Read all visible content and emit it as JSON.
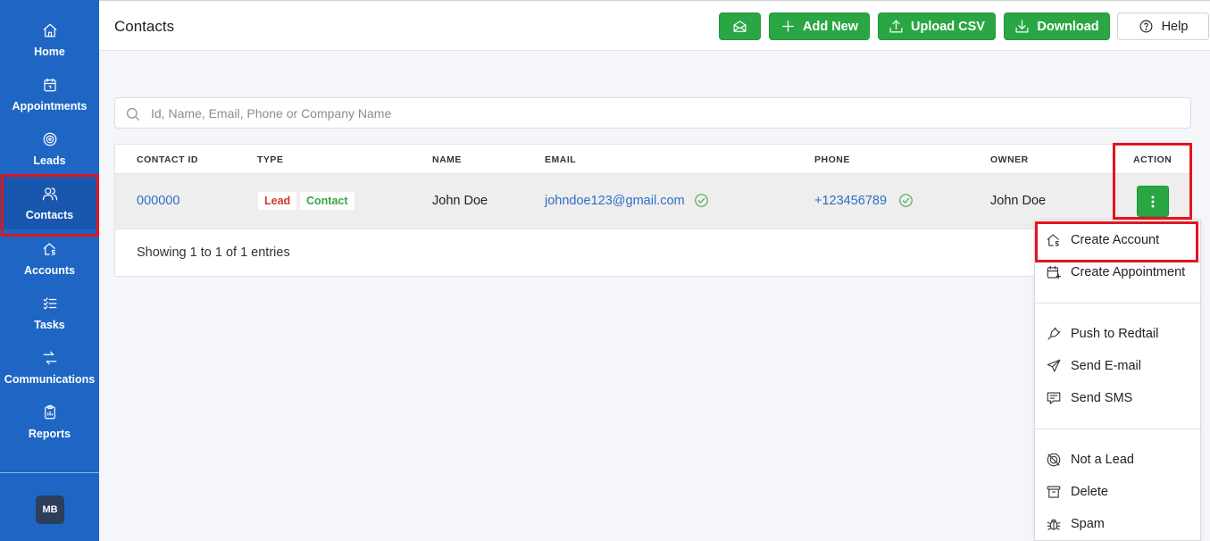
{
  "sidebar": {
    "items": [
      {
        "label": "Home",
        "icon": "home-icon"
      },
      {
        "label": "Appointments",
        "icon": "calendar-icon"
      },
      {
        "label": "Leads",
        "icon": "target-icon"
      },
      {
        "label": "Contacts",
        "icon": "users-icon"
      },
      {
        "label": "Accounts",
        "icon": "accounts-icon"
      },
      {
        "label": "Tasks",
        "icon": "checklist-icon"
      },
      {
        "label": "Communications",
        "icon": "arrows-icon"
      },
      {
        "label": "Reports",
        "icon": "clipboard-icon"
      }
    ],
    "active": "Contacts",
    "avatar_initials": "MB"
  },
  "header": {
    "title": "Contacts",
    "add_new_label": "Add New",
    "upload_csv_label": "Upload CSV",
    "download_label": "Download",
    "help_label": "Help"
  },
  "search": {
    "placeholder": "Id, Name, Email, Phone or Company Name",
    "value": ""
  },
  "table": {
    "columns": [
      "CONTACT ID",
      "TYPE",
      "NAME",
      "EMAIL",
      "PHONE",
      "OWNER",
      "ACTION"
    ],
    "rows": [
      {
        "contact_id": "000000",
        "types": [
          "Lead",
          "Contact"
        ],
        "name": "John Doe",
        "email": "johndoe123@gmail.com",
        "phone": "+123456789",
        "owner": "John Doe"
      }
    ],
    "footer": "Showing 1 to 1 of 1 entries"
  },
  "action_menu": {
    "items": [
      {
        "label": "Create Account",
        "icon": "accounts-icon"
      },
      {
        "label": "Create Appointment",
        "icon": "calendar-plus-icon"
      },
      {
        "label": "Push to Redtail",
        "icon": "plug-icon"
      },
      {
        "label": "Send E-mail",
        "icon": "send-icon"
      },
      {
        "label": "Send SMS",
        "icon": "sms-icon"
      },
      {
        "label": "Not a Lead",
        "icon": "target-off-icon"
      },
      {
        "label": "Delete",
        "icon": "archive-icon"
      },
      {
        "label": "Spam",
        "icon": "bug-icon"
      }
    ]
  },
  "colors": {
    "sidebar_bg": "#1f66c4",
    "primary_green": "#2aa744",
    "link_blue": "#2e6fc7",
    "annotation_red": "#e3141f",
    "lead_red": "#d0382f",
    "contact_green": "#3aa445"
  }
}
